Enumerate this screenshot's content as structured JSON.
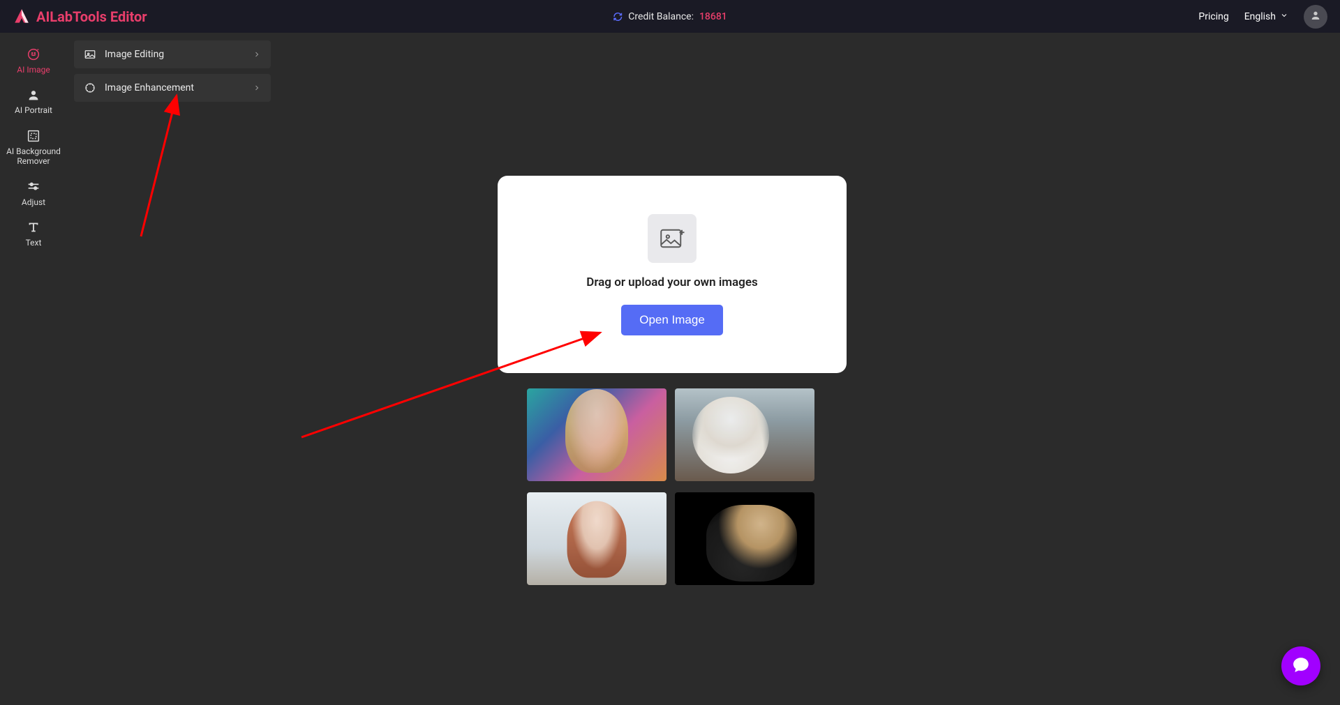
{
  "header": {
    "app_title": "AILabTools Editor",
    "credit_label": "Credit Balance:",
    "credit_value": "18681",
    "pricing_label": "Pricing",
    "language_label": "English"
  },
  "leftnav": {
    "items": [
      {
        "label": "AI Image"
      },
      {
        "label": "AI Portrait"
      },
      {
        "label": "AI Background\nRemover"
      },
      {
        "label": "Adjust"
      },
      {
        "label": "Text"
      }
    ]
  },
  "submenu": {
    "items": [
      {
        "label": "Image Editing"
      },
      {
        "label": "Image Enhancement"
      }
    ]
  },
  "upload": {
    "drag_text": "Drag or upload your own images",
    "open_button": "Open Image"
  }
}
